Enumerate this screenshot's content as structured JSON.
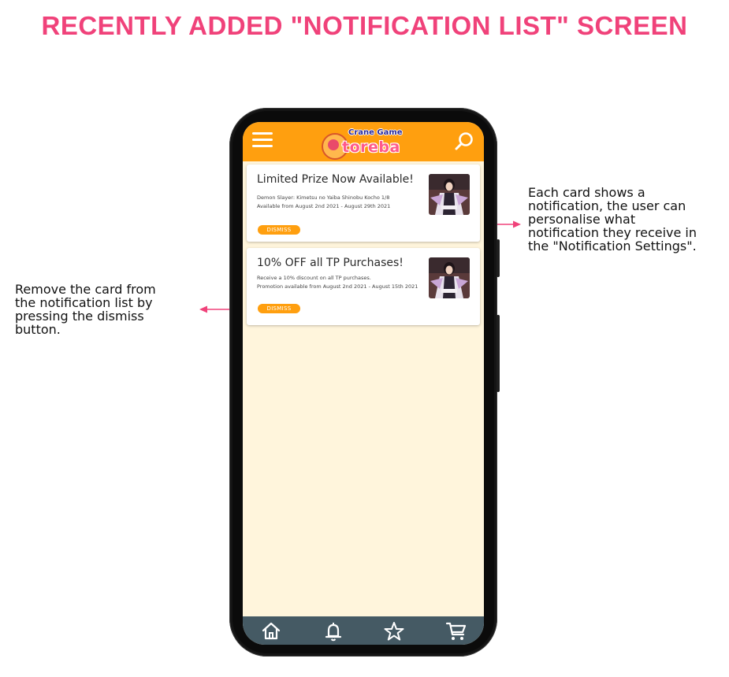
{
  "heading": {
    "title": "RECENTLY ADDED \"NOTIFICATION LIST\" SCREEN",
    "color": "#f0427a"
  },
  "annotations": {
    "left": "Remove the card from\nthe notification list by\npressing the dismiss\nbutton.",
    "right": "Each card shows a\nnotification, the user can\npersonalise what\nnotification they receive in\nthe \"Notification Settings\".",
    "arrow_color": "#f0427a"
  },
  "app": {
    "header": {
      "background": "#ff9f0f",
      "menu_icon": "hamburger-menu-icon",
      "search_icon": "search-icon",
      "logo_top": "Crane Game",
      "logo_main": "toreba"
    },
    "background": "#fff5dc",
    "notifications": [
      {
        "title": "Limited Prize Now Available!",
        "lines": [
          "Demon Slayer: Kimetsu no Yaiba Shinobu Kocho 1/8",
          "Available from August 2nd 2021 - August 29th 2021"
        ],
        "dismiss_label": "DISMISS",
        "thumbnail": "figure-thumbnail"
      },
      {
        "title": "10% OFF all TP Purchases!",
        "lines": [
          "Receive a 10% discount on all TP purchases.",
          "Promotion available from August 2nd 2021 - August 15th 2021"
        ],
        "dismiss_label": "DISMISS",
        "thumbnail": "figure-thumbnail"
      }
    ],
    "dismiss_color": "#ff9f0f",
    "bottom_nav": {
      "background": "#455a64",
      "items": [
        "home-icon",
        "bell-icon",
        "star-icon",
        "cart-icon"
      ]
    }
  }
}
